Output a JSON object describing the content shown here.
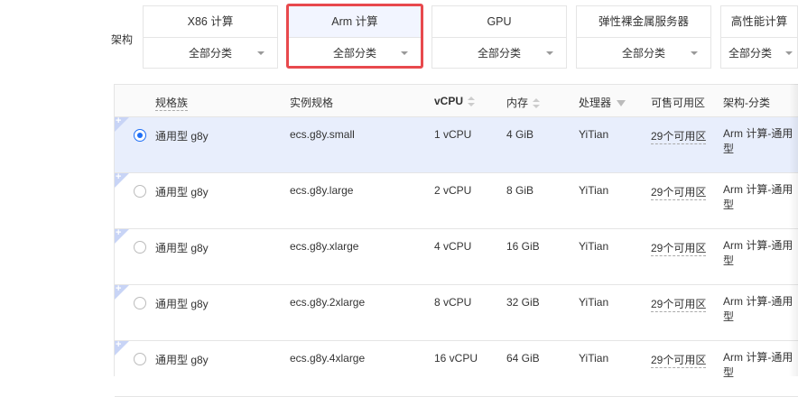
{
  "filter": {
    "label": "架构",
    "cards": [
      {
        "title": "X86 计算",
        "select": "全部分类"
      },
      {
        "title": "Arm 计算",
        "select": "全部分类"
      },
      {
        "title": "GPU",
        "select": "全部分类"
      },
      {
        "title": "弹性裸金属服务器",
        "select": "全部分类"
      },
      {
        "title": "高性能计算",
        "select": "全部分类"
      }
    ]
  },
  "table": {
    "headers": [
      "规格族",
      "实例规格",
      "vCPU",
      "内存",
      "处理器",
      "可售可用区",
      "架构-分类"
    ],
    "rows": [
      {
        "family": "通用型 g8y",
        "spec": "ecs.g8y.small",
        "vcpu": "1 vCPU",
        "mem": "4 GiB",
        "cpu": "YiTian",
        "zones": "29个可用区",
        "arch": "Arm 计算-通用型"
      },
      {
        "family": "通用型 g8y",
        "spec": "ecs.g8y.large",
        "vcpu": "2 vCPU",
        "mem": "8 GiB",
        "cpu": "YiTian",
        "zones": "29个可用区",
        "arch": "Arm 计算-通用型"
      },
      {
        "family": "通用型 g8y",
        "spec": "ecs.g8y.xlarge",
        "vcpu": "4 vCPU",
        "mem": "16 GiB",
        "cpu": "YiTian",
        "zones": "29个可用区",
        "arch": "Arm 计算-通用型"
      },
      {
        "family": "通用型 g8y",
        "spec": "ecs.g8y.2xlarge",
        "vcpu": "8 vCPU",
        "mem": "32 GiB",
        "cpu": "YiTian",
        "zones": "29个可用区",
        "arch": "Arm 计算-通用型"
      },
      {
        "family": "通用型 g8y",
        "spec": "ecs.g8y.4xlarge",
        "vcpu": "16 vCPU",
        "mem": "64 GiB",
        "cpu": "YiTian",
        "zones": "29个可用区",
        "arch": "Arm 计算-通用型"
      }
    ]
  }
}
